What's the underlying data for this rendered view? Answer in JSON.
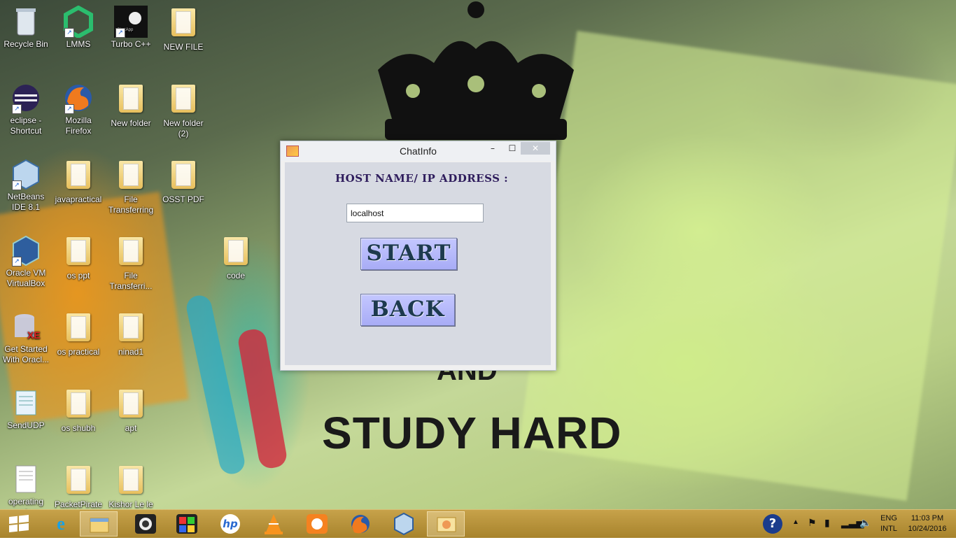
{
  "desktop": {
    "poster": {
      "line1": "AND",
      "line2": "STUDY HARD"
    },
    "icons": [
      {
        "label": "Recycle Bin",
        "icon": "recycle-bin-icon"
      },
      {
        "label": "LMMS",
        "icon": "lmms-icon"
      },
      {
        "label": "Turbo C++",
        "icon": "turbo-cpp-icon"
      },
      {
        "label": "NEW FILE",
        "icon": "folder-icon"
      },
      {
        "label": "eclipse - Shortcut",
        "icon": "eclipse-icon"
      },
      {
        "label": "Mozilla Firefox",
        "icon": "firefox-icon"
      },
      {
        "label": "New folder",
        "icon": "folder-icon"
      },
      {
        "label": "New folder (2)",
        "icon": "folder-icon"
      },
      {
        "label": "NetBeans IDE 8.1",
        "icon": "netbeans-icon"
      },
      {
        "label": "javapractical",
        "icon": "folder-icon"
      },
      {
        "label": "File Transferring",
        "icon": "folder-icon"
      },
      {
        "label": "OSST PDF",
        "icon": "folder-icon"
      },
      {
        "label": "Oracle VM VirtualBox",
        "icon": "virtualbox-icon"
      },
      {
        "label": "os ppt",
        "icon": "folder-icon"
      },
      {
        "label": "File Transferri...",
        "icon": "folder-icon"
      },
      {
        "label": "code",
        "icon": "folder-icon"
      },
      {
        "label": "Get Started With Oracl...",
        "icon": "oracle-xe-icon"
      },
      {
        "label": "os practical",
        "icon": "folder-icon"
      },
      {
        "label": "ninad1",
        "icon": "folder-icon"
      },
      {
        "label": "SendUDP",
        "icon": "notepad-icon"
      },
      {
        "label": "os shubh",
        "icon": "folder-icon"
      },
      {
        "label": "apt",
        "icon": "folder-icon"
      },
      {
        "label": "operating system",
        "icon": "text-file-icon"
      },
      {
        "label": "PacketPirate",
        "icon": "folder-icon"
      },
      {
        "label": "Kishor Le le",
        "icon": "folder-icon"
      }
    ]
  },
  "window": {
    "title": "ChatInfo",
    "minimize": "–",
    "maximize": "☐",
    "close": "✕",
    "host_label": "HOST NAME/ IP ADDRESS :",
    "host_value": "localhost",
    "start_label": "START",
    "back_label": "BACK"
  },
  "taskbar": {
    "apps": [
      "start-icon",
      "internet-explorer-icon",
      "file-explorer-icon",
      "media-player-icon",
      "paint-icon",
      "hp-icon",
      "vlc-icon",
      "uc-browser-icon",
      "firefox-icon",
      "virtualbox-icon",
      "java-app-icon"
    ],
    "tray": {
      "help": "?",
      "lang_top": "ENG",
      "lang_bottom": "INTL",
      "time": "11:03 PM",
      "date": "10/24/2016"
    }
  }
}
